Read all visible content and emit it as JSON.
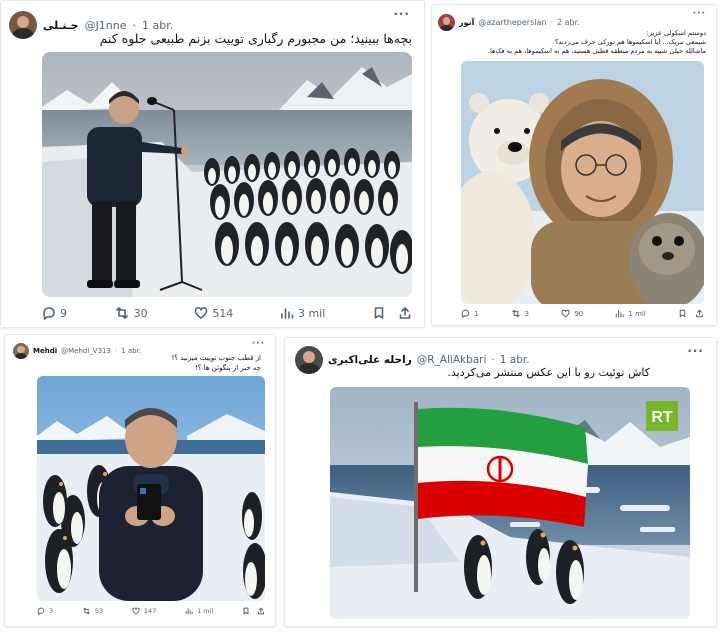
{
  "posts": [
    {
      "display_name": "جـنـلی",
      "handle": "@J1nne",
      "time": "1 abr.",
      "text": "بچه‌ها ببینید؛ من مجبورم رگباری توییت بزنم طبیعی جلوه کنم",
      "replies": "9",
      "reposts": "30",
      "likes": "514",
      "views": "3 mil"
    },
    {
      "display_name": "آنور",
      "handle": "@azarthepersian",
      "time": "2 abr.",
      "text_lines": [
        "دوستم اسکولی عزیز:",
        "شیمعی تبریک... آیا اسکیموها هم تورکی حرف می‌زدند؟",
        "ماشالله خیلی شبیه به مردم منطقه قطبی هستید. هم به اسکیموها، هم به فک‌ها."
      ],
      "replies": "1",
      "reposts": "3",
      "likes": "90",
      "views": "1 mil"
    },
    {
      "display_name": "Mehdi",
      "handle": "@Mehdi_V313",
      "time": "1 abr.",
      "text_lines": [
        "از قطب جنوب توییت میزنید ؟!",
        "چه خبر از پنگوئن ها ؟!"
      ],
      "replies": "3",
      "reposts": "53",
      "likes": "147",
      "views": "1 mil"
    },
    {
      "display_name": "راحله علی‌اکبری",
      "handle": "@R_AliAkbari",
      "time": "1 abr.",
      "text": "کاش توئیت رو با این عکس منتشر می‌کردید.",
      "watermark": "RT"
    }
  ],
  "colors": {
    "text": "#0f1419",
    "meta": "#536471",
    "border": "#e6e9ec",
    "flag_green": "#239f40",
    "flag_red": "#da0000",
    "rt_green": "#77b82a"
  }
}
